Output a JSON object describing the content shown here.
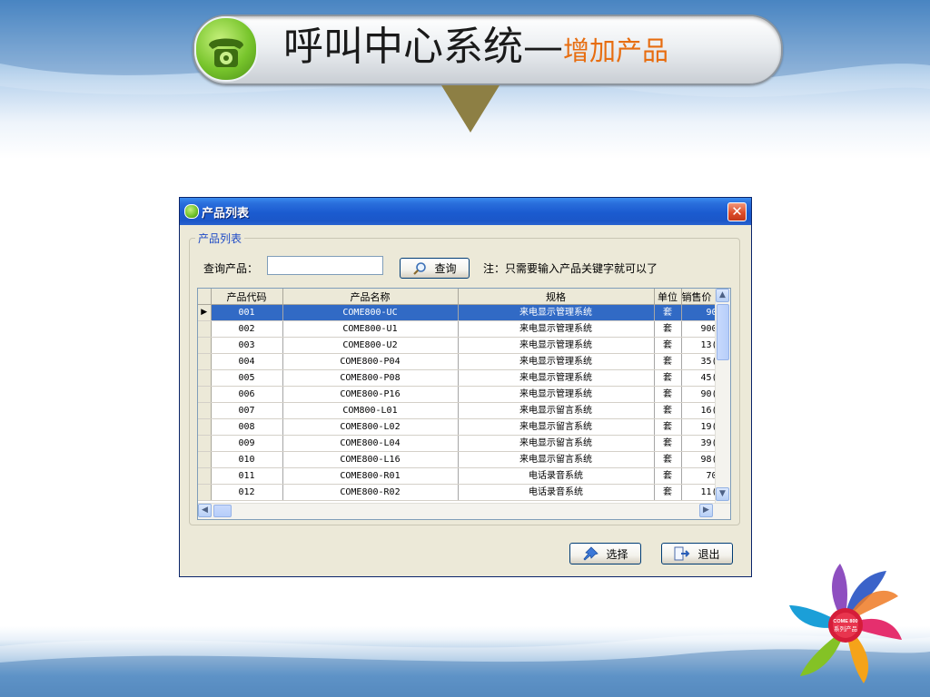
{
  "slide": {
    "title": "呼叫中心系统—",
    "subtitle": "增加产品"
  },
  "dialog": {
    "title": "产品列表",
    "group_label": "产品列表",
    "search_label": "查询产品：",
    "search_value": "",
    "search_button": "查询",
    "note": "注：只需要输入产品关键字就可以了",
    "select_button": "选择",
    "exit_button": "退出"
  },
  "grid": {
    "columns": [
      "产品代码",
      "产品名称",
      "规格",
      "单位",
      "销售价"
    ],
    "rows": [
      [
        "001",
        "COME800-UC",
        "来电显示管理系统",
        "套",
        "90"
      ],
      [
        "002",
        "COME800-U1",
        "来电显示管理系统",
        "套",
        "900"
      ],
      [
        "003",
        "COME800-U2",
        "来电显示管理系统",
        "套",
        "13("
      ],
      [
        "004",
        "COME800-P04",
        "来电显示管理系统",
        "套",
        "35("
      ],
      [
        "005",
        "COME800-P08",
        "来电显示管理系统",
        "套",
        "45("
      ],
      [
        "006",
        "COME800-P16",
        "来电显示管理系统",
        "套",
        "90("
      ],
      [
        "007",
        "COM800-L01",
        "来电显示留言系统",
        "套",
        "16("
      ],
      [
        "008",
        "COME800-L02",
        "来电显示留言系统",
        "套",
        "19("
      ],
      [
        "009",
        "COME800-L04",
        "来电显示留言系统",
        "套",
        "39("
      ],
      [
        "010",
        "COME800-L16",
        "来电显示留言系统",
        "套",
        "98("
      ],
      [
        "011",
        "COME800-R01",
        "电话录音系统",
        "套",
        "70"
      ],
      [
        "012",
        "COME800-R02",
        "电话录音系统",
        "套",
        "11("
      ]
    ],
    "selected_row": 0
  },
  "logo": {
    "line1": "COME 800",
    "line2": "系列产品"
  },
  "colors": {
    "accent_orange": "#e76d10",
    "selection_blue": "#316ac5",
    "titlebar_blue": "#1b5bd0"
  }
}
